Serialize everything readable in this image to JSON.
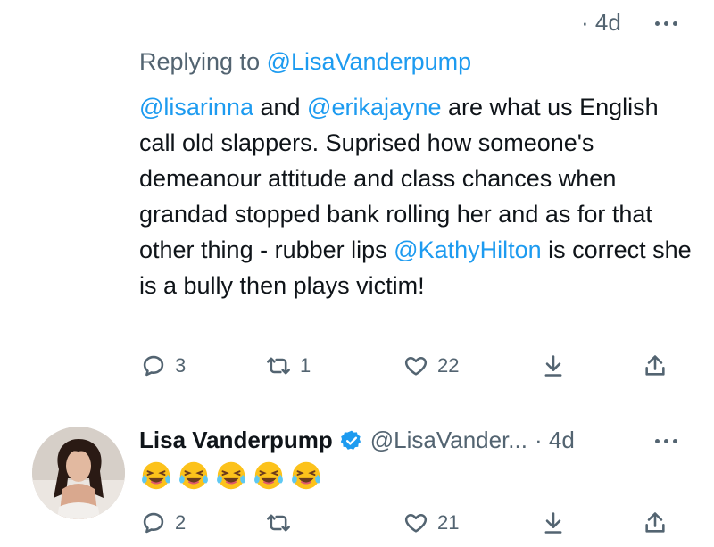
{
  "tweet1": {
    "time": "· 4d",
    "replying_prefix": "Replying to ",
    "replying_handle": "@LisaVanderpump",
    "text": {
      "mention1": "@lisarinna",
      "t1": " and ",
      "mention2": "@erikajayne",
      "t2": " are what us English call old slappers. Suprised how someone's demeanour attitude and class chances when grandad stopped bank rolling her and as for that other thing - rubber lips ",
      "mention3": "@KathyHilton",
      "t3": " is correct she is a bully then plays victim!"
    },
    "actions": {
      "replies": "3",
      "retweets": "1",
      "likes": "22"
    }
  },
  "tweet2": {
    "name": "Lisa Vanderpump",
    "handle": "@LisaVander...",
    "time": "· 4d",
    "emoji_count": 5,
    "emoji": "face-with-tears-of-joy",
    "actions": {
      "replies": "2",
      "retweets": "",
      "likes": "21"
    }
  },
  "icons": [
    "more-icon",
    "reply-icon",
    "retweet-icon",
    "like-icon",
    "bookmark-icon",
    "share-icon",
    "verified-badge-icon"
  ],
  "colors": {
    "link": "#1d9bf0",
    "secondary": "#536471",
    "text": "#0f1419"
  }
}
